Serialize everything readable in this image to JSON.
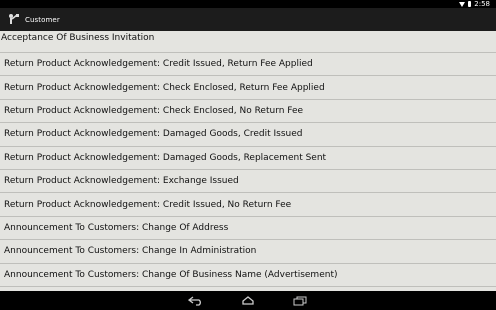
{
  "status_bar": {
    "time": "2:58",
    "icons": [
      "wifi-icon",
      "battery-icon"
    ]
  },
  "action_bar": {
    "title": "Customer",
    "icon": "app-icon"
  },
  "list_items": [
    "Acceptance Of Business Invitation",
    "Return Product Acknowledgement: Credit Issued, Return Fee Applied",
    "Return Product Acknowledgement: Check Enclosed, Return Fee Applied",
    "Return Product Acknowledgement: Check Enclosed, No Return Fee",
    "Return Product Acknowledgement: Damaged Goods, Credit Issued",
    "Return Product Acknowledgement: Damaged Goods, Replacement Sent",
    "Return Product Acknowledgement: Exchange Issued",
    "Return Product Acknowledgement: Credit Issued, No Return Fee",
    "Announcement To Customers: Change Of Address",
    "Announcement To Customers: Change In Administration",
    "Announcement To Customers: Change Of Business Name (Advertisement)"
  ],
  "nav_bar": {
    "buttons": [
      "back-icon",
      "home-icon",
      "recent-apps-icon"
    ]
  },
  "colors": {
    "background": "#e4e4e0",
    "action_bar": "#1c1c1c",
    "status_bar": "#000000"
  }
}
